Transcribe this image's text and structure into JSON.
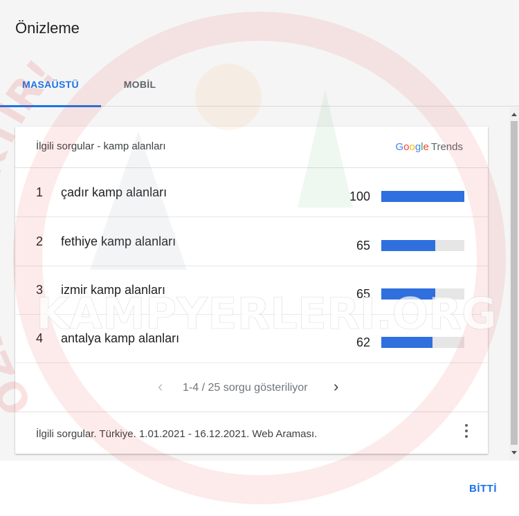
{
  "dialog": {
    "title": "Önizleme",
    "tabs": [
      {
        "label": "MASAÜSTÜ",
        "active": true
      },
      {
        "label": "MOBİL",
        "active": false
      }
    ],
    "done_label": "BİTTİ"
  },
  "card": {
    "title": "İlgili sorgular - kamp alanları",
    "logo": {
      "google": [
        "G",
        "o",
        "o",
        "g",
        "l",
        "e"
      ],
      "trends": "Trends"
    },
    "rows": [
      {
        "rank": "1",
        "query": "çadır kamp alanları",
        "value": "100",
        "fraction": 1.0
      },
      {
        "rank": "2",
        "query": "fethiye kamp alanları",
        "value": "65",
        "fraction": 0.65
      },
      {
        "rank": "3",
        "query": "izmir kamp alanları",
        "value": "65",
        "fraction": 0.65
      },
      {
        "rank": "4",
        "query": "antalya kamp alanları",
        "value": "62",
        "fraction": 0.62
      }
    ],
    "pager_text": "1-4 / 25 sorgu gösteriliyor",
    "footer": "İlgili sorgular. Türkiye. 1.01.2021 - 16.12.2021. Web Araması."
  },
  "watermark": {
    "site": "KAMPYERLERI.ORG",
    "stamp": "ÖZEL ÇEKİKTİR!"
  },
  "colors": {
    "accent": "#1a73e8",
    "bar": "#2f6fde",
    "watermark_red": "#e53935"
  }
}
